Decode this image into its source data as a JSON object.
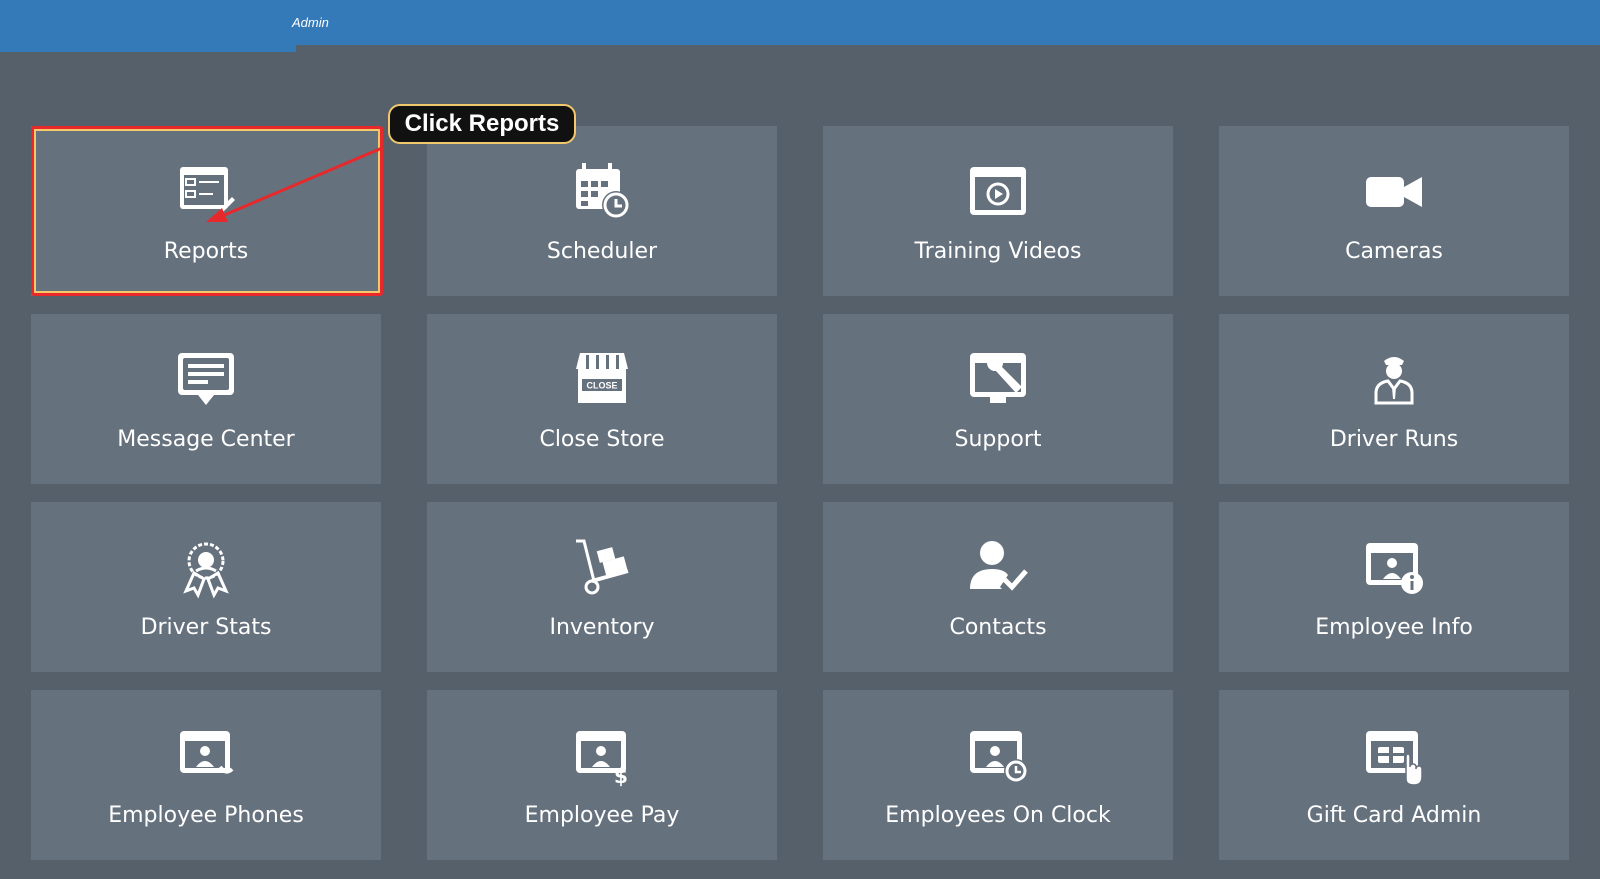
{
  "header": {
    "text": "Admin"
  },
  "callout": {
    "text": "Click Reports"
  },
  "tiles": [
    {
      "label": "Reports",
      "icon": "reports-icon"
    },
    {
      "label": "Scheduler",
      "icon": "calendar-clock-icon"
    },
    {
      "label": "Training Videos",
      "icon": "video-player-icon"
    },
    {
      "label": "Cameras",
      "icon": "video-camera-icon"
    },
    {
      "label": "Message Center",
      "icon": "message-bubble-icon"
    },
    {
      "label": "Close Store",
      "icon": "store-close-icon"
    },
    {
      "label": "Support",
      "icon": "wrench-screen-icon"
    },
    {
      "label": "Driver Runs",
      "icon": "driver-person-icon"
    },
    {
      "label": "Driver Stats",
      "icon": "award-badge-icon"
    },
    {
      "label": "Inventory",
      "icon": "hand-truck-icon"
    },
    {
      "label": "Contacts",
      "icon": "person-check-icon"
    },
    {
      "label": "Employee Info",
      "icon": "employee-info-icon"
    },
    {
      "label": "Employee Phones",
      "icon": "employee-phone-icon"
    },
    {
      "label": "Employee Pay",
      "icon": "employee-pay-icon"
    },
    {
      "label": "Employees On Clock",
      "icon": "employee-clock-icon"
    },
    {
      "label": "Gift Card Admin",
      "icon": "gift-card-icon"
    }
  ],
  "colors": {
    "header": "#3479b8",
    "background": "#56606b",
    "tile": "#66717e",
    "highlight": "#e8292b"
  }
}
